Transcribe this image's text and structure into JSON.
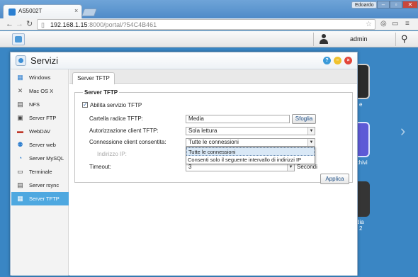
{
  "browser": {
    "tab_title": "AS5002T",
    "tab_close": "×",
    "os_user": "Edoardo",
    "url_host": "192.168.1.15",
    "url_rest": ":8000/portal/?54C4B461"
  },
  "nas_bar": {
    "username": "admin"
  },
  "desktop": {
    "label_1": "e",
    "label_2": "rchivi",
    "label_3": "dia",
    "label_4": "2"
  },
  "window": {
    "title": "Servizi"
  },
  "sidebar": {
    "items": [
      {
        "label": "Windows",
        "icon": "windows-icon"
      },
      {
        "label": "Mac OS X",
        "icon": "mac-icon"
      },
      {
        "label": "NFS",
        "icon": "nfs-icon"
      },
      {
        "label": "Server FTP",
        "icon": "ftp-icon"
      },
      {
        "label": "WebDAV",
        "icon": "webdav-icon"
      },
      {
        "label": "Server web",
        "icon": "web-icon"
      },
      {
        "label": "Server MySQL",
        "icon": "mysql-icon"
      },
      {
        "label": "Terminale",
        "icon": "terminal-icon"
      },
      {
        "label": "Server rsync",
        "icon": "rsync-icon"
      },
      {
        "label": "Server TFTP",
        "icon": "tftp-icon"
      }
    ],
    "active": "Server TFTP"
  },
  "content": {
    "tab_label": "Server TFTP",
    "group_title": "Server TFTP",
    "enable_label": "Abilita servizio TFTP",
    "enable_checked": true,
    "root_label": "Cartella radice TFTP:",
    "root_value": "Media",
    "browse_label": "Sfoglia",
    "auth_label": "Autorizzazione client TFTP:",
    "auth_value": "Sola lettura",
    "conn_label": "Connessione client consentita:",
    "conn_value": "Tutte le connessioni",
    "conn_options": [
      "Tutte le connessioni",
      "Consenti solo il seguente intervallo di indirizzi IP"
    ],
    "ip_label": "Indirizzo IP:",
    "timeout_label": "Timeout:",
    "timeout_value": "3",
    "timeout_unit": "Secondi",
    "apply_label": "Applica"
  },
  "colors": {
    "desktop_bg": "#3a86c4",
    "active_item": "#4ea8e0"
  }
}
